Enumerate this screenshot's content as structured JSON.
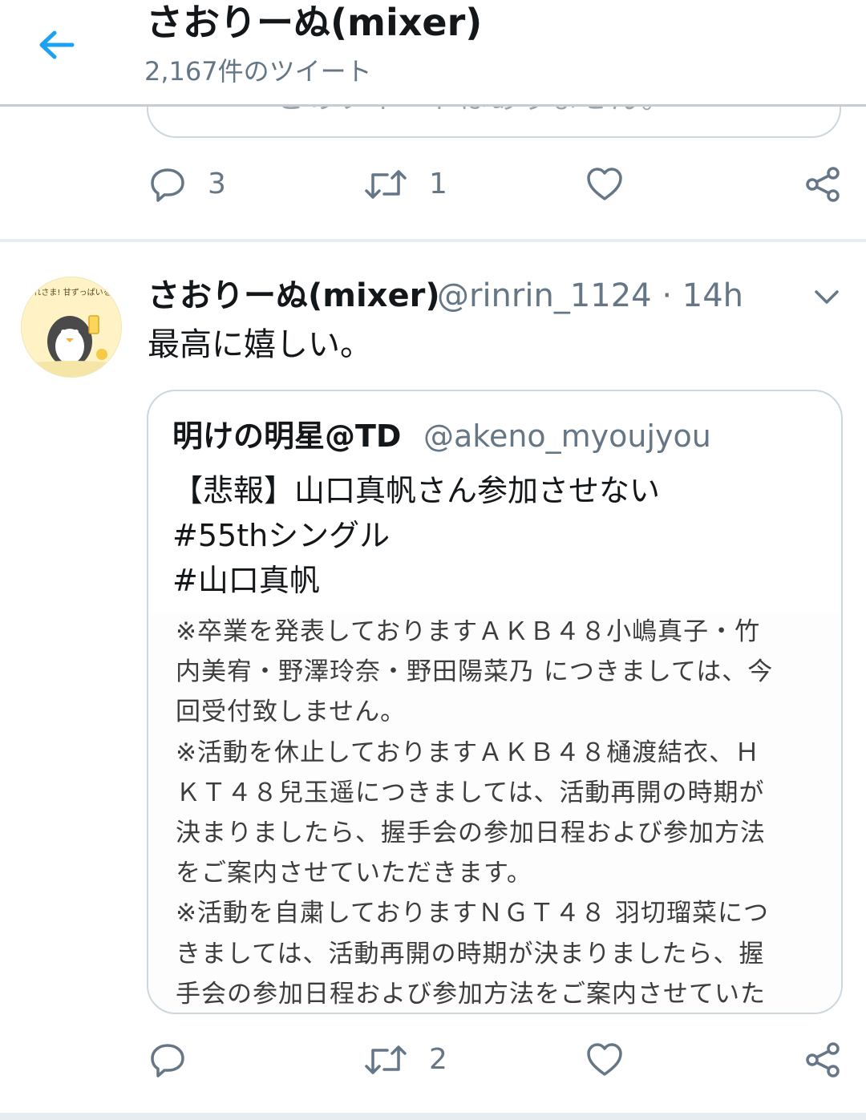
{
  "header": {
    "title": "さおりーぬ(mixer)",
    "tweet_count": "2,167件のツイート"
  },
  "previous_tweet": {
    "card_text": "このツイートはありません。",
    "reply_count": "3",
    "retweet_count": "1"
  },
  "tweet": {
    "author_name": "さおりーぬ(mixer)",
    "author_handle": "@rinrin_1124 · 14h",
    "text": "最高に嬉しい。",
    "avatar_caption": "おつかれさま! 甘ずっぱいをどうぞ",
    "reply_count": "",
    "retweet_count": "2",
    "quote": {
      "author_name": "明けの明星@TD",
      "author_handle": "@akeno_myoujyou",
      "lines": [
        "【悲報】山口真帆さん参加させない",
        "#55thシングル",
        "#山口真帆"
      ],
      "image_text_lines": [
        "※卒業を発表しておりますＡＫＢ４８小嶋真子・竹",
        "内美宥・野澤玲奈・野田陽菜乃 につきましては、今",
        "回受付致しません。",
        "※活動を休止しておりますＡＫＢ４８樋渡結衣、Ｈ",
        "ＫＴ４８兒玉遥につきましては、活動再開の時期が",
        "決まりましたら、握手会の参加日程および参加方法",
        "をご案内させていただきます。",
        "※活動を自粛しておりますＮＧＴ４８ 羽切瑠菜につ",
        "きましては、活動再開の時期が決まりましたら、握",
        "手会の参加日程および参加方法をご案内させていた"
      ]
    }
  },
  "colors": {
    "accent": "#1da1f2",
    "text_primary": "#14171a",
    "text_secondary": "#657786",
    "border": "#ccd6dd"
  },
  "icons": {
    "back": "arrow-left-icon",
    "reply": "reply-icon",
    "retweet": "retweet-icon",
    "like": "heart-icon",
    "share": "share-icon",
    "caret": "chevron-down-icon"
  }
}
